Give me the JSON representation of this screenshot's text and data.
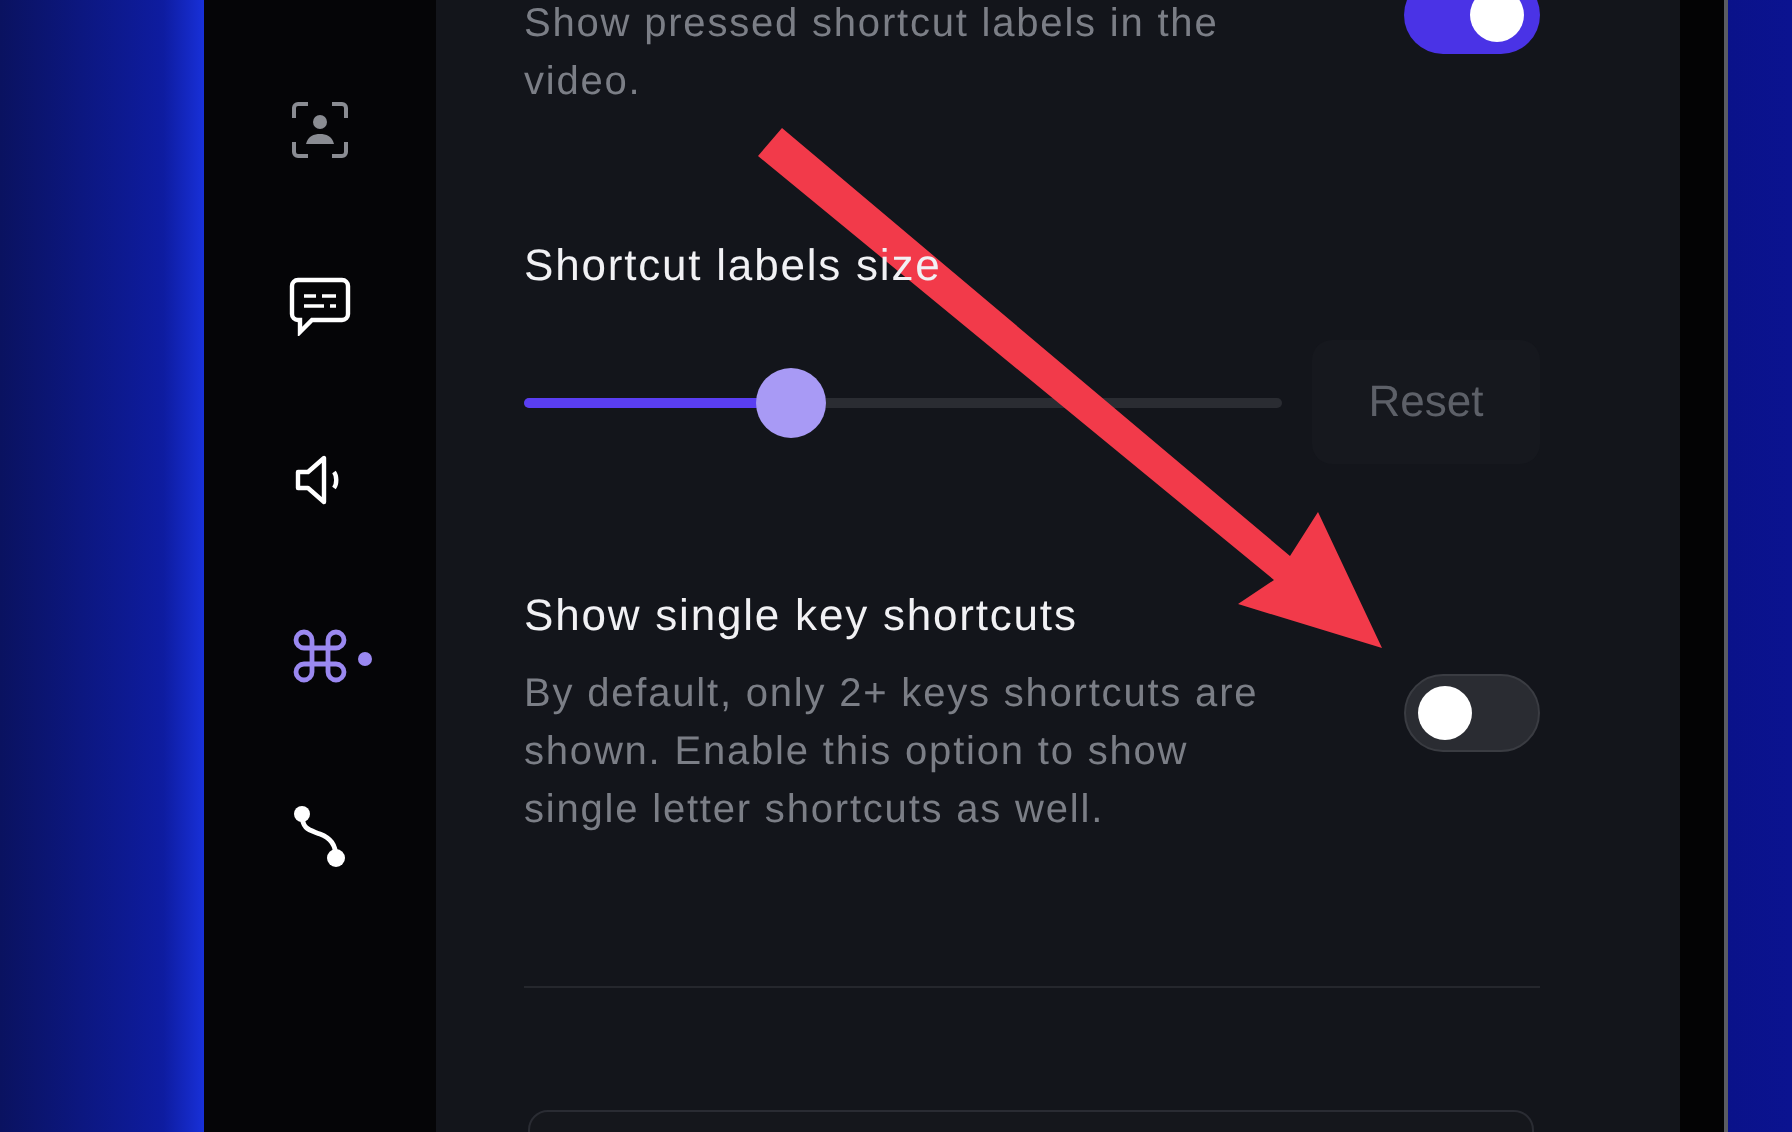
{
  "sidebar": {
    "items": [
      {
        "selected": false
      },
      {
        "selected": false
      },
      {
        "selected": false
      },
      {
        "selected": true
      },
      {
        "selected": false
      }
    ]
  },
  "settings": [
    {
      "kind": "toggle",
      "description": "Show pressed shortcut labels in the video.",
      "on": true
    },
    {
      "kind": "slider",
      "title": "Shortcut labels size",
      "level": 0.35,
      "button": "Reset"
    },
    {
      "kind": "toggle",
      "title": "Show single key shortcuts",
      "description": "By default, only 2+ keys shortcuts are shown. Enable this option to show single letter shortcuts as well.",
      "on": false
    }
  ]
}
